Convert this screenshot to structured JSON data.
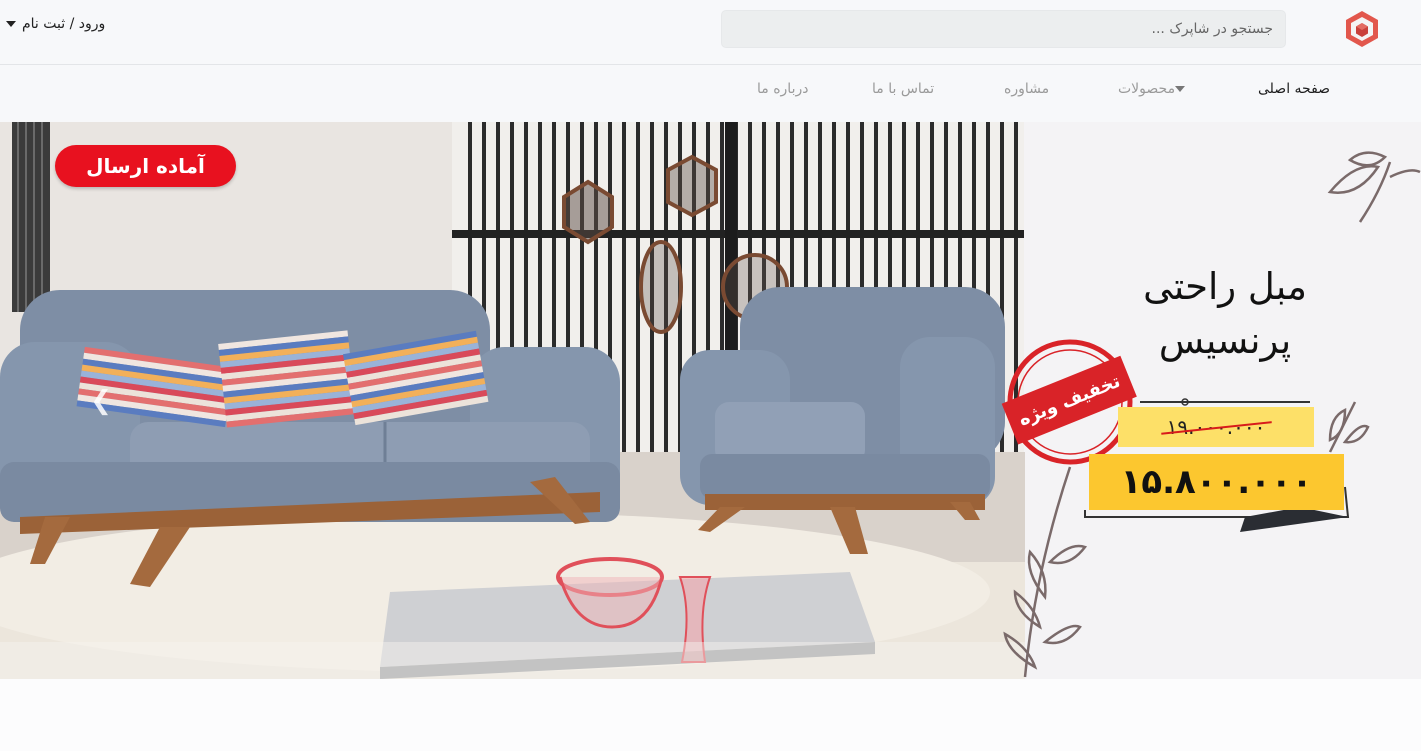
{
  "header": {
    "logo_icon": "store-box-logo-icon",
    "search": {
      "placeholder": "جستجو در شاپرک ..."
    },
    "account": {
      "label": "ورود / ثبت نام",
      "icon": "caret-down-icon"
    }
  },
  "nav": {
    "items": [
      {
        "label": "صفحه اصلی",
        "active": true
      },
      {
        "label": "محصولات",
        "has_dropdown": true
      },
      {
        "label": "مشاوره"
      },
      {
        "label": "تماس با ما"
      },
      {
        "label": "درباره ما"
      }
    ]
  },
  "hero": {
    "badge": "آماده ارسال",
    "title_line1": "مبل راحتی",
    "title_line2": "پرنسیس",
    "stamp": "تخفیف ویژه",
    "old_price": "۱۹.۰۰۰.۰۰۰",
    "new_price": "۱۵.۸۰۰.۰۰۰",
    "prev_icon": "chevron-left-icon",
    "colors": {
      "badge": "#e8111f",
      "price_bg": "#fcc72f",
      "stamp": "#d92328"
    }
  }
}
